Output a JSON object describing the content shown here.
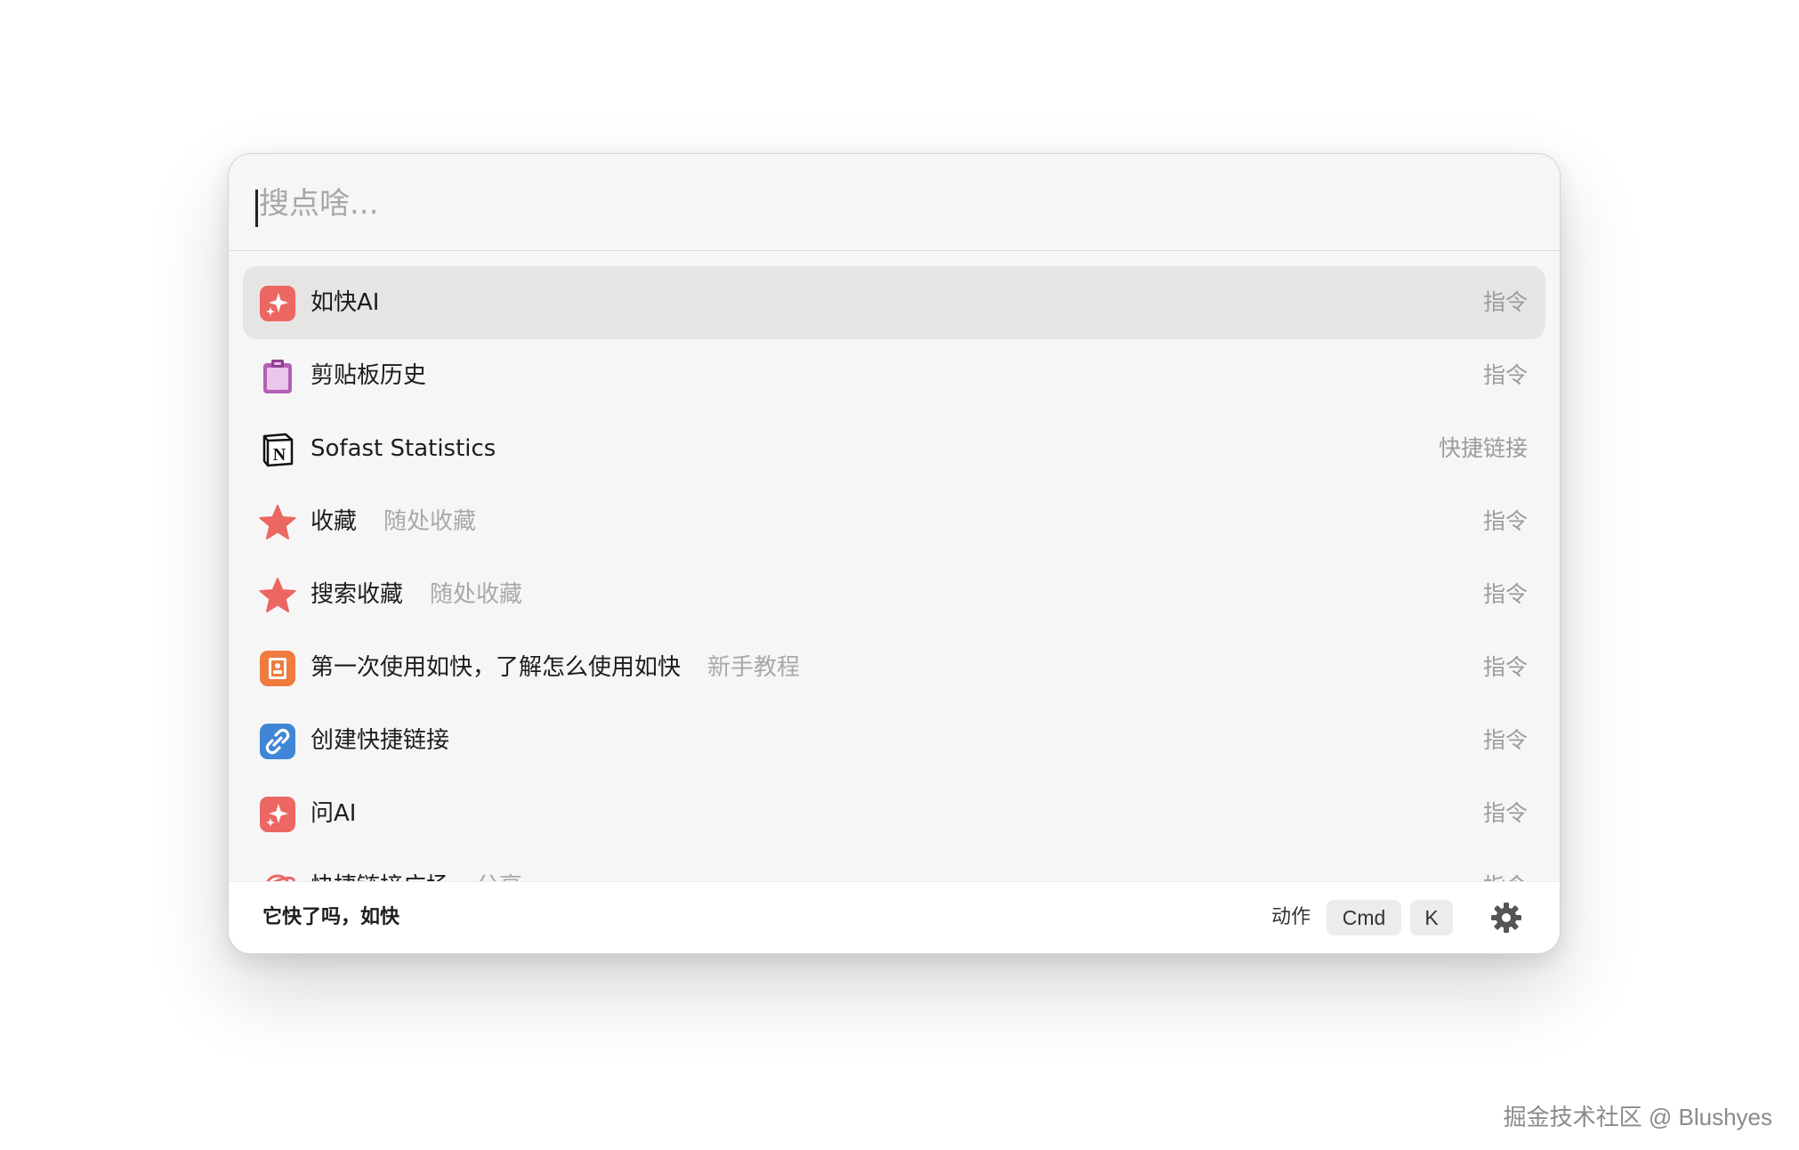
{
  "search": {
    "placeholder": "搜点啥...",
    "value": ""
  },
  "results": [
    {
      "title": "如快AI",
      "subtitle": "",
      "kind": "指令",
      "icon": "sparkle-icon",
      "selected": true
    },
    {
      "title": "剪贴板历史",
      "subtitle": "",
      "kind": "指令",
      "icon": "clipboard-icon",
      "selected": false
    },
    {
      "title": "Sofast Statistics",
      "subtitle": "",
      "kind": "快捷链接",
      "icon": "notion-icon",
      "selected": false
    },
    {
      "title": "收藏",
      "subtitle": "随处收藏",
      "kind": "指令",
      "icon": "star-icon",
      "selected": false
    },
    {
      "title": "搜索收藏",
      "subtitle": "随处收藏",
      "kind": "指令",
      "icon": "star-icon",
      "selected": false
    },
    {
      "title": "第一次使用如快，了解怎么使用如快",
      "subtitle": "新手教程",
      "kind": "指令",
      "icon": "guide-book-icon",
      "selected": false
    },
    {
      "title": "创建快捷链接",
      "subtitle": "",
      "kind": "指令",
      "icon": "link-icon",
      "selected": false
    },
    {
      "title": "问AI",
      "subtitle": "",
      "kind": "指令",
      "icon": "sparkle-icon",
      "selected": false
    },
    {
      "title": "快捷链接广场",
      "subtitle": "分享",
      "kind": "指令",
      "icon": "planet-icon",
      "selected": false
    }
  ],
  "footer": {
    "slogan": "它快了吗，如快",
    "action_label": "动作",
    "key_cmd": "Cmd",
    "key_k": "K"
  },
  "watermark": "掘金技术社区 @ Blushyes",
  "colors": {
    "accent_red": "#ec6762",
    "clipboard_purple": "#b45fb5",
    "guide_orange": "#ef7b3e",
    "link_blue": "#3f86d6"
  }
}
